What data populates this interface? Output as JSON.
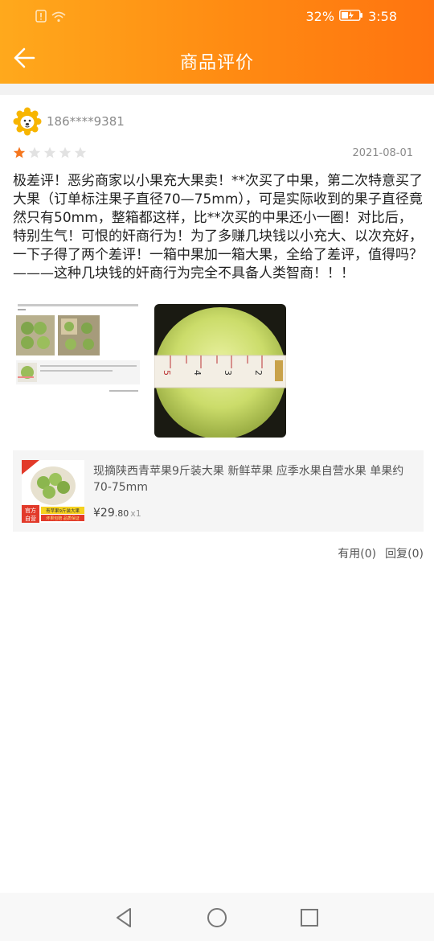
{
  "status_bar": {
    "battery": "32%",
    "time": "3:58"
  },
  "header": {
    "title": "商品评价"
  },
  "review": {
    "username": "186****9381",
    "rating": 1,
    "max_rating": 5,
    "date": "2021-08-01",
    "text": "极差评！恶劣商家以小果充大果卖！**次买了中果，第二次特意买了大果（订单标注果子直径70—75mm），可是实际收到的果子直径竟然只有50mm，整箱都这样，比**次买的中果还小一圈！对比后，特别生气！可恨的奸商行为！为了多赚几块钱以小充大、以次充好，一下子得了两个差评！一箱中果加一箱大果，全给了差评，值得吗？———这种几块钱的奸商行为完全不具备人类智商！！！"
  },
  "product": {
    "title": "现摘陕西青苹果9斤装大果 新鲜苹果 应季水果自营水果 单果约70-75mm",
    "price_main": "¥29",
    "price_cents": ".80",
    "quantity": "x1",
    "thumb_badge_1": "官方",
    "thumb_badge_2": "自营",
    "thumb_banner": "青苹果9斤装大果",
    "thumb_sub": "坏果包赔 品质保证"
  },
  "actions": {
    "useful": "有用(0)",
    "reply": "回复(0)"
  },
  "colors": {
    "header_start": "#ffa91c",
    "header_end": "#ff7410",
    "star_active": "#f5761e",
    "star_inactive": "#e2e2e2"
  }
}
